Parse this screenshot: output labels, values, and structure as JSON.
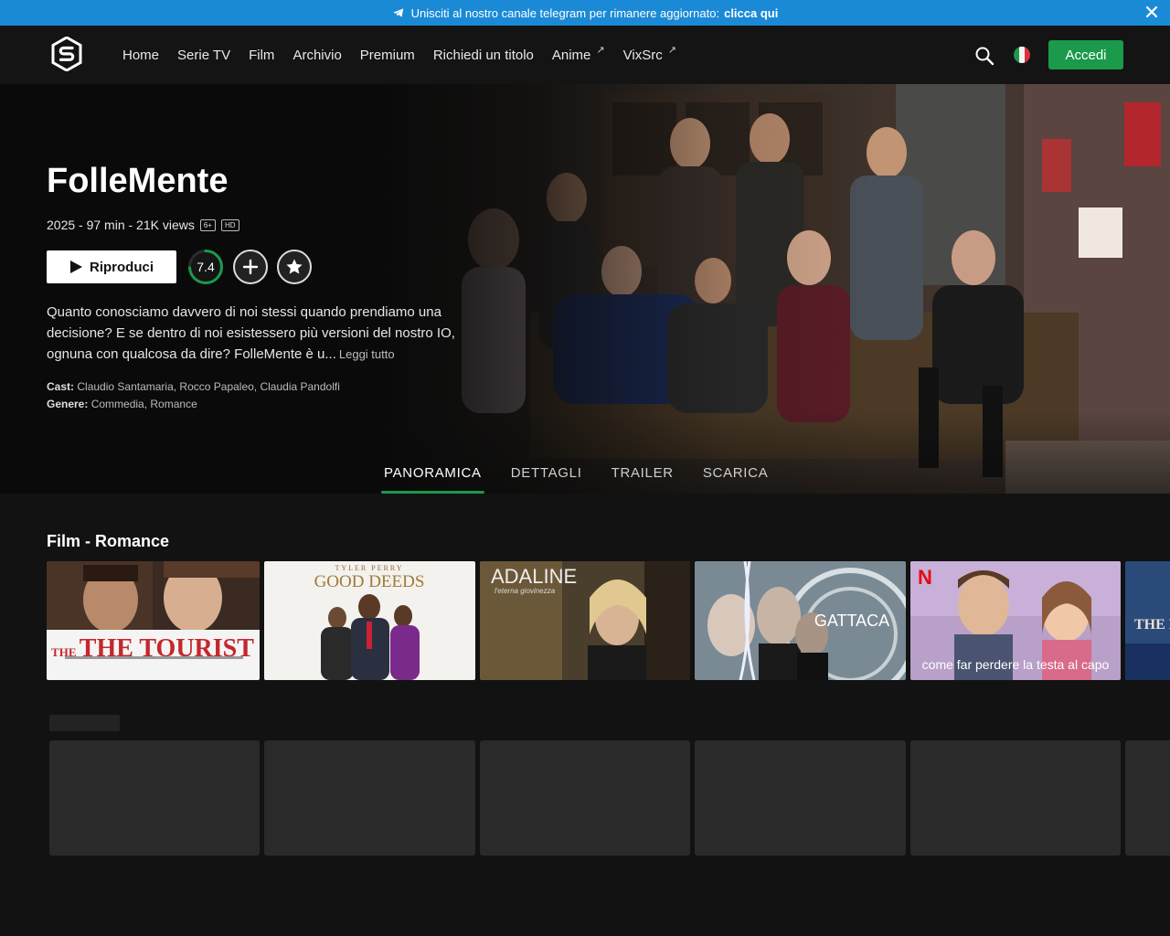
{
  "banner": {
    "text": "Unisciti al nostro canale telegram per rimanere aggiornato:",
    "cta": "clicca qui"
  },
  "nav": {
    "links": [
      "Home",
      "Serie TV",
      "Film",
      "Archivio",
      "Premium",
      "Richiedi un titolo",
      "Anime",
      "VixSrc"
    ],
    "login_label": "Accedi",
    "accent": "#1a9a4a"
  },
  "hero": {
    "title": "FolleMente",
    "meta": "2025 - 97 min - 21K views",
    "badges": [
      "6+",
      "HD"
    ],
    "play_label": "Riproduci",
    "rating": "7.4",
    "rating_fraction": 0.74,
    "description": "Quanto conosciamo davvero di noi stessi quando prendiamo una decisione? E se dentro di noi esistessero più versioni del nostro IO, ognuna con qualcosa da dire? FolleMente è u...",
    "read_more": "Leggi tutto",
    "cast_label": "Cast:",
    "cast": "Claudio Santamaria, Rocco Papaleo, Claudia Pandolfi",
    "genre_label": "Genere:",
    "genre": "Commedia, Romance"
  },
  "tabs": [
    "PANORAMICA",
    "DETTAGLI",
    "TRAILER",
    "SCARICA"
  ],
  "row": {
    "title": "Film - Romance",
    "cards": [
      {
        "title": "THE TOURIST"
      },
      {
        "title": "GOOD DEEDS",
        "top": "TYLER PERRY"
      },
      {
        "title": "ADALINE",
        "sub": "l'eterna giovinezza"
      },
      {
        "title": "GATTACA"
      },
      {
        "title": "come far perdere la testa al capo",
        "brand": "N"
      },
      {
        "title": "THE LOV"
      }
    ]
  }
}
